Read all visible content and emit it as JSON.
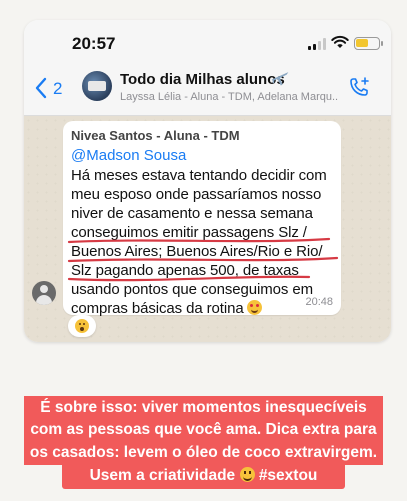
{
  "status_bar": {
    "time": "20:57"
  },
  "header": {
    "back_count": "2",
    "group_name": "Todo dia Milhas alunos",
    "group_members": "Layssa Lélia - Aluna - TDM, Adelana Marqu..."
  },
  "message": {
    "sender": "Nivea Santos - Aluna - TDM",
    "mention": "@Madson Sousa",
    "lines": [
      "Há meses estava tentando decidir com",
      "meu esposo onde passaríamos nosso",
      "niver de casamento e nessa semana",
      "conseguimos emitir passagens Slz /",
      "Buenos Aires; Buenos Aires/Rio e Rio/",
      "Slz pagando apenas 500, de taxas",
      "usando pontos que conseguimos em",
      "compras básicas da rotina"
    ],
    "time": "20:48",
    "underline_color": "#d63a44",
    "reaction": "astonished-face"
  },
  "caption": {
    "background": "#f15a5a",
    "lines": [
      "É sobre isso: viver momentos inesquecíveis",
      "com as pessoas que você ama. Dica extra para",
      "os casados: levem o óleo de coco extravirgem.",
      "Usem a criatividade"
    ],
    "hashtag": "#sextou"
  }
}
